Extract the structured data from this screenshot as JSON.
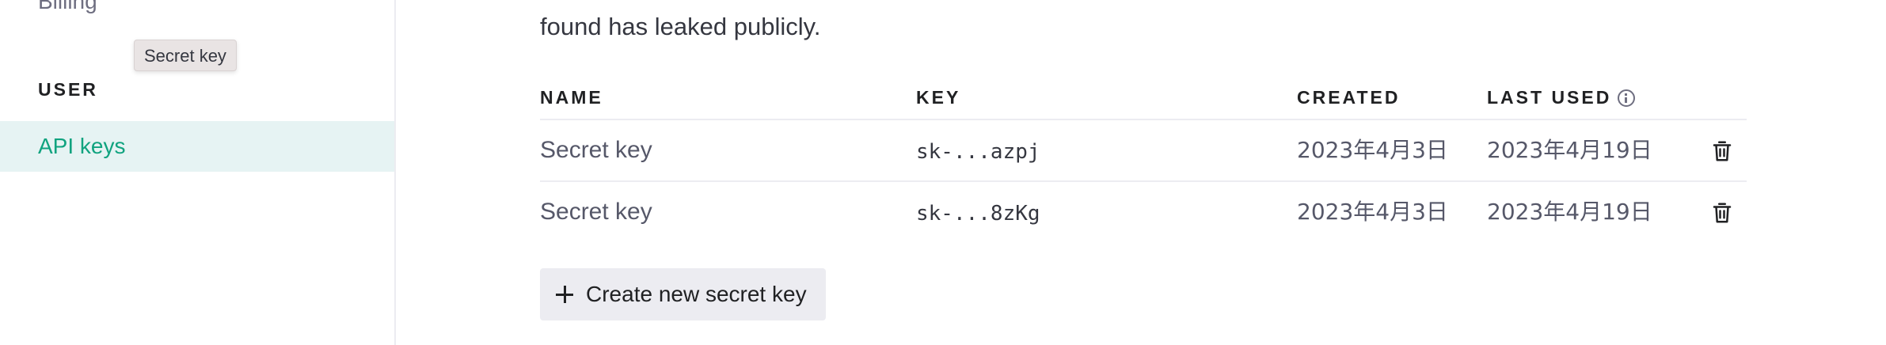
{
  "sidebar": {
    "partial_item": "Billing",
    "section_heading": "USER",
    "active_item": "API keys",
    "tooltip": "Secret key"
  },
  "main": {
    "intro_line": "found has leaked publicly.",
    "table": {
      "headers": {
        "name": "NAME",
        "key": "KEY",
        "created": "CREATED",
        "last_used": "LAST USED"
      },
      "rows": [
        {
          "name": "Secret key",
          "key": "sk-...azpj",
          "created": "2023年4月3日",
          "last_used": "2023年4月19日"
        },
        {
          "name": "Secret key",
          "key": "sk-...8zKg",
          "created": "2023年4月3日",
          "last_used": "2023年4月19日"
        }
      ]
    },
    "create_button": "Create new secret key"
  },
  "icons": {
    "info": "info-circle-icon",
    "delete": "trash-icon",
    "add": "plus-icon"
  },
  "colors": {
    "accent": "#10a37f",
    "active_bg": "#e6f3f3",
    "button_bg": "#ececf1",
    "divider": "#ececf1"
  }
}
